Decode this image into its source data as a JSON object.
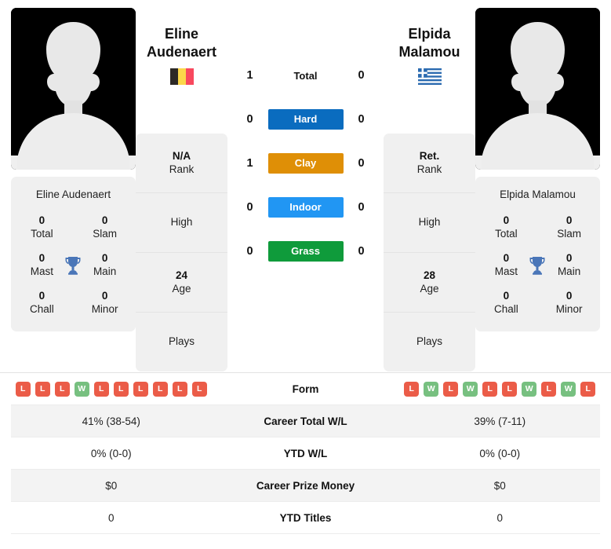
{
  "players": {
    "left": {
      "first_name": "Eline",
      "last_name": "Audenaert",
      "full_name": "Eline Audenaert",
      "country": "Belgium",
      "flag_icon": "belgium-flag-icon",
      "photo_icon": "player-silhouette-photo",
      "rank_value": "N/A",
      "rank_label": "Rank",
      "high_label": "High",
      "high_value": "",
      "age_value": "24",
      "age_label": "Age",
      "plays_label": "Plays",
      "plays_value": "",
      "titles": {
        "total_num": "0",
        "total_lbl": "Total",
        "slam_num": "0",
        "slam_lbl": "Slam",
        "mast_num": "0",
        "mast_lbl": "Mast",
        "main_num": "0",
        "main_lbl": "Main",
        "chall_num": "0",
        "chall_lbl": "Chall",
        "minor_num": "0",
        "minor_lbl": "Minor"
      },
      "form": [
        "L",
        "L",
        "L",
        "W",
        "L",
        "L",
        "L",
        "L",
        "L",
        "L"
      ],
      "career_wl": "41% (38-54)",
      "ytd_wl": "0% (0-0)",
      "career_prize": "$0",
      "ytd_titles": "0"
    },
    "right": {
      "first_name": "Elpida",
      "last_name": "Malamou",
      "full_name": "Elpida Malamou",
      "country": "Greece",
      "flag_icon": "greece-flag-icon",
      "photo_icon": "player-silhouette-photo",
      "rank_value": "Ret.",
      "rank_label": "Rank",
      "high_label": "High",
      "high_value": "",
      "age_value": "28",
      "age_label": "Age",
      "plays_label": "Plays",
      "plays_value": "",
      "titles": {
        "total_num": "0",
        "total_lbl": "Total",
        "slam_num": "0",
        "slam_lbl": "Slam",
        "mast_num": "0",
        "mast_lbl": "Mast",
        "main_num": "0",
        "main_lbl": "Main",
        "chall_num": "0",
        "chall_lbl": "Chall",
        "minor_num": "0",
        "minor_lbl": "Minor"
      },
      "form": [
        "L",
        "W",
        "L",
        "W",
        "L",
        "L",
        "W",
        "L",
        "W",
        "L"
      ],
      "career_wl": "39% (7-11)",
      "ytd_wl": "0% (0-0)",
      "career_prize": "$0",
      "ytd_titles": "0"
    }
  },
  "head_to_head": [
    {
      "label": "Total",
      "left": "1",
      "right": "0",
      "badge": false,
      "color": ""
    },
    {
      "label": "Hard",
      "left": "0",
      "right": "0",
      "badge": true,
      "color": "#0a6cbf"
    },
    {
      "label": "Clay",
      "left": "1",
      "right": "0",
      "badge": true,
      "color": "#df8f06"
    },
    {
      "label": "Indoor",
      "left": "0",
      "right": "0",
      "badge": true,
      "color": "#2196f3"
    },
    {
      "label": "Grass",
      "left": "0",
      "right": "0",
      "badge": true,
      "color": "#0f9b3b"
    }
  ],
  "table": {
    "rows": [
      {
        "label": "Form",
        "type": "form"
      },
      {
        "label": "Career Total W/L",
        "type": "text",
        "left": "41% (38-54)",
        "right": "39% (7-11)"
      },
      {
        "label": "YTD W/L",
        "type": "text",
        "left": "0% (0-0)",
        "right": "0% (0-0)"
      },
      {
        "label": "Career Prize Money",
        "type": "text",
        "left": "$0",
        "right": "$0"
      },
      {
        "label": "YTD Titles",
        "type": "text",
        "left": "0",
        "right": "0"
      }
    ]
  },
  "colors": {
    "win_badge": "#eb5c48",
    "loss_badge": "#eb5c48",
    "win": "#77c080",
    "loss": "#eb5c48",
    "card_bg": "#f0f0f0",
    "trophy": "#4a76b8"
  }
}
